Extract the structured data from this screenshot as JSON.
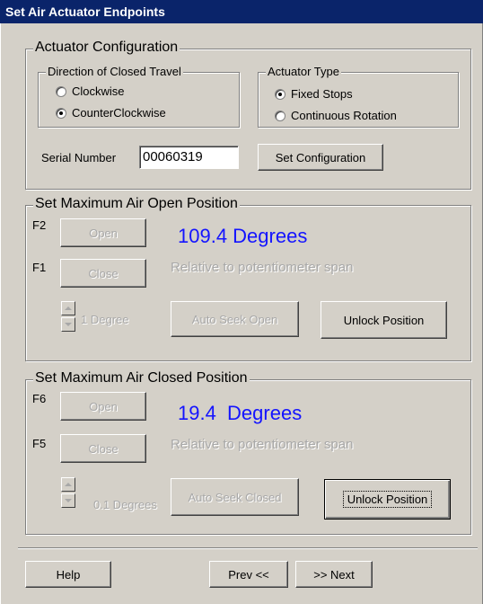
{
  "window": {
    "title": "Set Air Actuator Endpoints"
  },
  "config": {
    "legend": "Actuator Configuration",
    "direction": {
      "legend": "Direction of Closed Travel",
      "options": [
        "Clockwise",
        "CounterClockwise"
      ],
      "selected": "CounterClockwise"
    },
    "type": {
      "legend": "Actuator Type",
      "options": [
        "Fixed Stops",
        "Continuous Rotation"
      ],
      "selected": "Fixed Stops"
    },
    "serial_label": "Serial Number",
    "serial_value": "00060319",
    "set_button": "Set Configuration"
  },
  "open_section": {
    "legend": "Set Maximum Air Open Position",
    "f_open": "F2",
    "open_label": "Open",
    "f_close": "F1",
    "close_label": "Close",
    "degrees": "109.4 Degrees",
    "relative": "Relative to potentiometer span",
    "step": "1 Degree",
    "auto_seek": "Auto Seek Open",
    "unlock": "Unlock Position"
  },
  "closed_section": {
    "legend": "Set Maximum Air Closed Position",
    "f_open": "F6",
    "open_label": "Open",
    "f_close": "F5",
    "close_label": "Close",
    "degrees": "19.4  Degrees",
    "relative": "Relative to potentiometer span",
    "step": "0.1 Degrees",
    "auto_seek": "Auto Seek Closed",
    "unlock": "Unlock Position"
  },
  "footer": {
    "help": "Help",
    "prev": "Prev <<",
    "next": ">> Next"
  },
  "colors": {
    "titlebar": "#0a246a",
    "degrees_text": "#1414ff",
    "face": "#d4d0c8"
  }
}
